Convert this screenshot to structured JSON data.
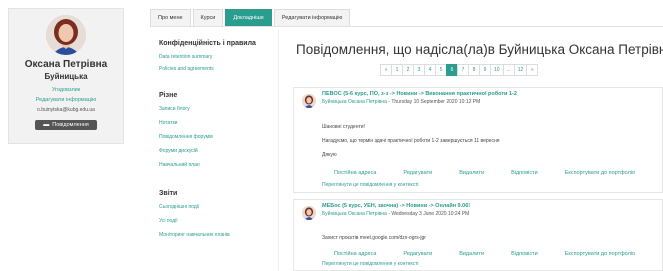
{
  "profile": {
    "first_name": "Оксана Петрівна",
    "last_name": "Буйницька",
    "role_link": "Угодовзлик",
    "edit_link": "Редагувати інформацію",
    "email": "o.buinytska@kubg.edu.ua",
    "message_button": "Повідомлення"
  },
  "tabs": [
    "Про мене",
    "Курси",
    "Докладніше",
    "Редагувати інформацію"
  ],
  "menu": {
    "privacy_heading": "Конфіденційність і правила",
    "privacy_links": [
      "Data retention summary",
      "Policies and agreements"
    ],
    "misc_heading": "Різне",
    "misc_links": [
      "Записи блогу",
      "Нотатки",
      "Повідомлення форумів",
      "Форуми дискусій",
      "Навчальний план"
    ],
    "reports_heading": "Звіти",
    "report_links": [
      "Сьогоднішні події",
      "Усі події",
      "Моніторинг навчальних планів"
    ]
  },
  "main": {
    "title": "Повідомлення, що надісла(ла)в Буйницька Оксана Петрівна",
    "pager": [
      "«",
      "1",
      "2",
      "3",
      "4",
      "5",
      "6",
      "7",
      "8",
      "9",
      "10",
      "...",
      "12",
      "»"
    ],
    "pager_active": "6"
  },
  "posts": [
    {
      "subject": "ПЕВОС (5-6 курс, ПО, з-з -> Новини -> Виконання практичної роботи 1-2",
      "author": "Буйницька Оксана Петрівна",
      "date": " - Thursday 10 September 2020 10:12 PM",
      "lines": [
        "Шановні студенти!",
        "Нагадуємо, що термін здачі практичної роботи 1-2 завершується 11 вересня",
        "Дякую"
      ],
      "actions": [
        "Постійна адреса",
        "Редагувати",
        "Видалити",
        "Відповісти",
        "Експортувати до портфоліо"
      ],
      "permalink": "Переглянути це повідомлення у контексті"
    },
    {
      "subject": "МЕБос (5 курс, УЕН, заочна) -> Новини -> Онлайн 9.06!",
      "author": "Буйницька Оксана Петрівна",
      "date": " - Wednesday 3 June 2020 10:24 PM",
      "lines": [
        "Захист проєктів meet.google.com/dzx-ogrs-jgr"
      ],
      "actions": [
        "Постійна адреса",
        "Редагувати",
        "Видалити",
        "Відповісти",
        "Експортувати до портфоліо"
      ],
      "permalink": "Переглянути це повідомлення у контексті"
    }
  ],
  "colors": {
    "accent": "#2a9d8f",
    "button": "#555555"
  }
}
